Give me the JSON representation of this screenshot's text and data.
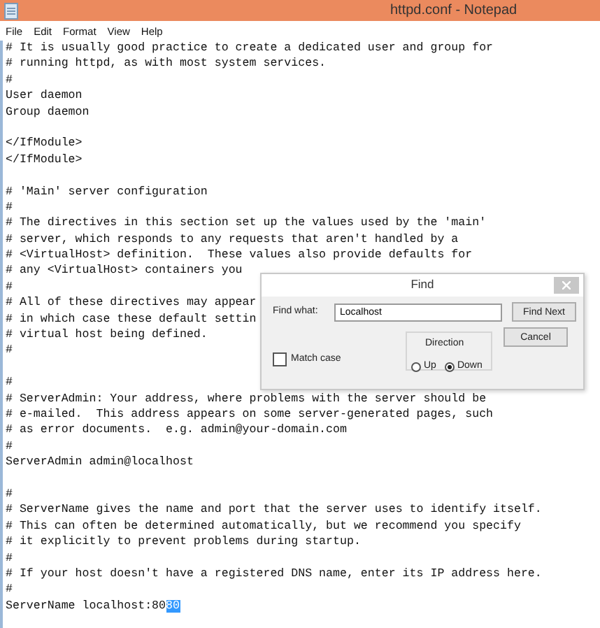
{
  "window": {
    "title": "httpd.conf - Notepad"
  },
  "menu": [
    "File",
    "Edit",
    "Format",
    "View",
    "Help"
  ],
  "editor": {
    "paragraphs": [
      [
        {
          "text": "# It is usually good practice to create a dedicated user and group for"
        },
        {
          "text": "# running httpd, as with most system services."
        },
        {
          "text": "#"
        },
        {
          "text": "User daemon"
        },
        {
          "text": "Group daemon"
        }
      ],
      [
        {
          "text": "</IfModule>"
        },
        {
          "text": "</IfModule>"
        }
      ],
      [
        {
          "text": "# 'Main' server configuration"
        },
        {
          "text": "#"
        },
        {
          "text": "# The directives in this section set up the values used by the 'main'"
        },
        {
          "text": "# server, which responds to any requests that aren't handled by a"
        },
        {
          "text": "# <VirtualHost> definition.  These values also provide defaults for"
        },
        {
          "text": "# any <VirtualHost> containers you"
        },
        {
          "text": "#"
        },
        {
          "text": "# All of these directives may appear"
        },
        {
          "text": "# in which case these default settin"
        },
        {
          "text": "# virtual host being defined."
        },
        {
          "text": "#"
        }
      ],
      [
        {
          "text": "#"
        },
        {
          "text": "# ServerAdmin: Your address, where problems with the server should be"
        },
        {
          "text": "# e-mailed.  This address appears on some server-generated pages, such"
        },
        {
          "text": "# as error documents.  e.g. admin@your-domain.com"
        },
        {
          "text": "#"
        },
        {
          "text": "ServerAdmin admin@localhost"
        }
      ],
      [
        {
          "text": "#"
        },
        {
          "text": "# ServerName gives the name and port that the server uses to identify itself."
        },
        {
          "text": "# This can often be determined automatically, but we recommend you specify"
        },
        {
          "text": "# it explicitly to prevent problems during startup."
        },
        {
          "text": "#"
        },
        {
          "text": "# If your host doesn't have a registered DNS name, enter its IP address here."
        },
        {
          "text": "#"
        },
        {
          "text": "ServerName localhost:80",
          "selected_text": "80"
        }
      ]
    ]
  },
  "find_dialog": {
    "title": "Find",
    "find_what_label": "Find what:",
    "find_what_value": "Localhost",
    "find_next": "Find Next",
    "cancel": "Cancel",
    "direction_label": "Direction",
    "directions": [
      {
        "label": "Up",
        "selected": false
      },
      {
        "label": "Down",
        "selected": true
      }
    ],
    "match_case": {
      "label": "Match case",
      "checked": false
    }
  }
}
